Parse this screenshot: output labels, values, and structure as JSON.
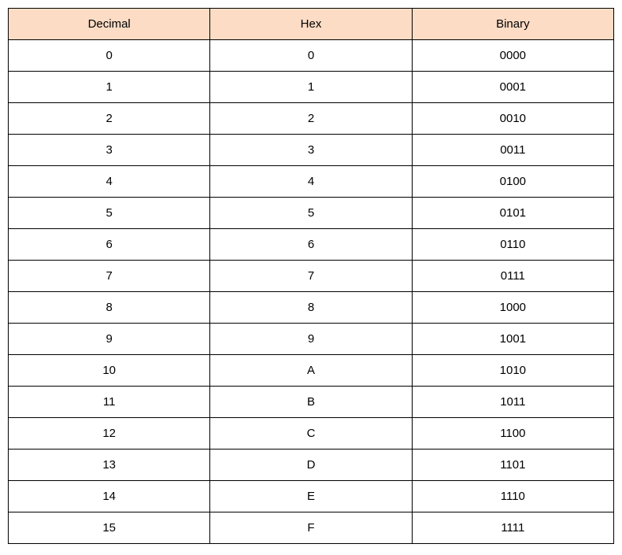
{
  "chart_data": {
    "type": "table",
    "title": "",
    "headers": [
      "Decimal",
      "Hex",
      "Binary"
    ],
    "rows": [
      {
        "decimal": "0",
        "hex": "0",
        "binary": "0000"
      },
      {
        "decimal": "1",
        "hex": "1",
        "binary": "0001"
      },
      {
        "decimal": "2",
        "hex": "2",
        "binary": "0010"
      },
      {
        "decimal": "3",
        "hex": "3",
        "binary": "0011"
      },
      {
        "decimal": "4",
        "hex": "4",
        "binary": "0100"
      },
      {
        "decimal": "5",
        "hex": "5",
        "binary": "0101"
      },
      {
        "decimal": "6",
        "hex": "6",
        "binary": "0110"
      },
      {
        "decimal": "7",
        "hex": "7",
        "binary": "0111"
      },
      {
        "decimal": "8",
        "hex": "8",
        "binary": "1000"
      },
      {
        "decimal": "9",
        "hex": "9",
        "binary": "1001"
      },
      {
        "decimal": "10",
        "hex": "A",
        "binary": "1010"
      },
      {
        "decimal": "11",
        "hex": "B",
        "binary": "1011"
      },
      {
        "decimal": "12",
        "hex": "C",
        "binary": "1100"
      },
      {
        "decimal": "13",
        "hex": "D",
        "binary": "1101"
      },
      {
        "decimal": "14",
        "hex": "E",
        "binary": "1110"
      },
      {
        "decimal": "15",
        "hex": "F",
        "binary": "1111"
      }
    ]
  }
}
